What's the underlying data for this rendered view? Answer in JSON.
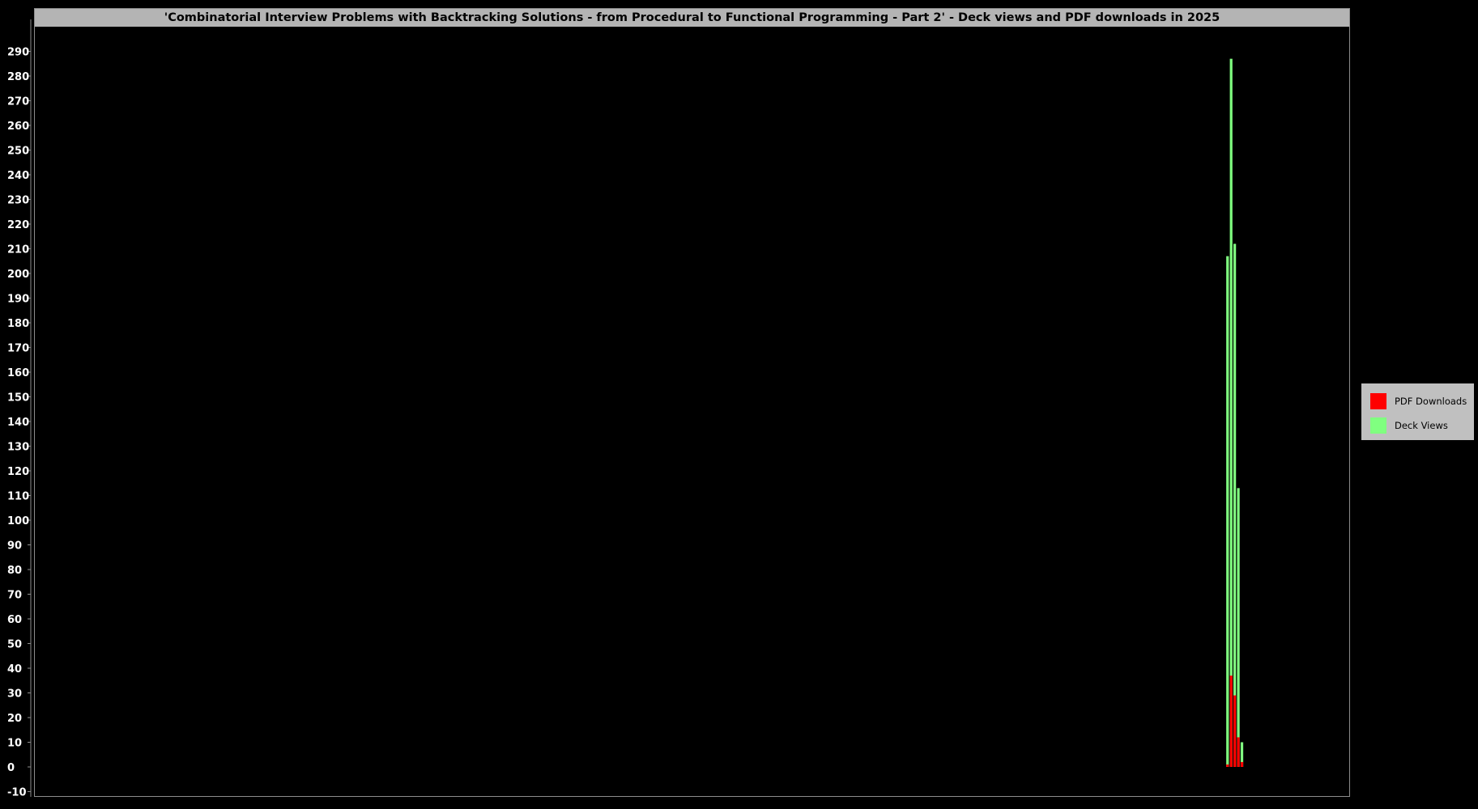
{
  "chart_data": {
    "type": "bar",
    "stacked": "overlay",
    "title": "'Combinatorial Interview Problems with Backtracking Solutions - from Procedural to Functional Programming - Part 2' - Deck views and PDF downloads in 2025",
    "xlabel": "",
    "ylabel": "",
    "ylim": [
      -10,
      295
    ],
    "yticks": [
      -10,
      0,
      10,
      20,
      30,
      40,
      50,
      60,
      70,
      80,
      90,
      100,
      110,
      120,
      130,
      140,
      150,
      160,
      170,
      180,
      190,
      200,
      210,
      220,
      230,
      240,
      250,
      260,
      270,
      280,
      290
    ],
    "x_range": [
      0,
      365
    ],
    "x": [
      331,
      332,
      333,
      334,
      335
    ],
    "grid": false,
    "legend": "right",
    "series": [
      {
        "name": "Deck Views",
        "color": "#80ff80",
        "values": [
          207,
          287,
          212,
          113,
          10
        ]
      },
      {
        "name": "PDF Downloads",
        "color": "#ff0000",
        "values": [
          1,
          37,
          29,
          12,
          2
        ]
      }
    ]
  },
  "colors": {
    "background": "#000000",
    "title_bar": "#b4b4b4",
    "axis": "#8c8c8c",
    "legend_bg": "#c0c0c0"
  }
}
